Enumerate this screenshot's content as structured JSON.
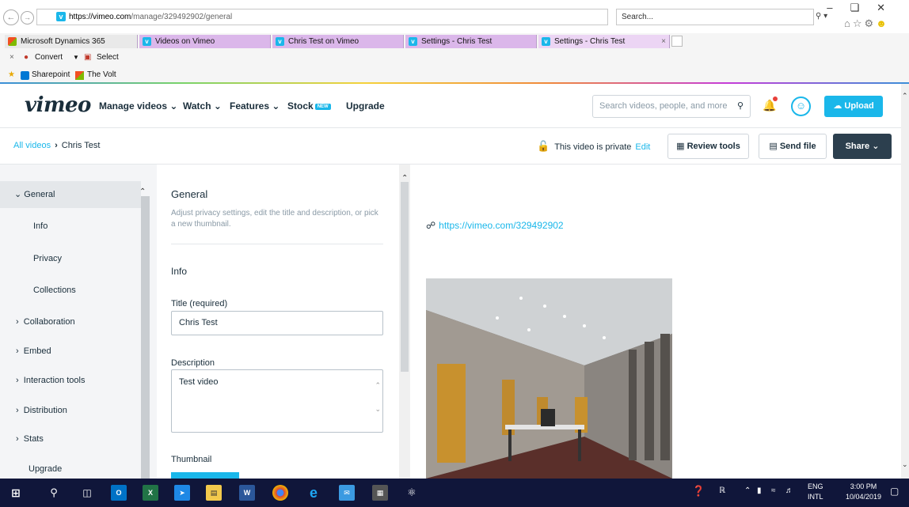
{
  "browser": {
    "url_base": "https://vimeo.com",
    "url_path": "/manage/329492902/general",
    "search_placeholder": "Search...",
    "tabs": [
      {
        "label": "Microsoft Dynamics 365"
      },
      {
        "label": "Videos on Vimeo"
      },
      {
        "label": "Chris Test on Vimeo"
      },
      {
        "label": "Settings - Chris Test"
      },
      {
        "label": "Settings - Chris Test"
      }
    ],
    "cmd_bar": {
      "convert": "Convert",
      "select": "Select"
    },
    "favorites": [
      {
        "label": "Sharepoint"
      },
      {
        "label": "The Volt"
      }
    ]
  },
  "vimeo": {
    "logo": "vimeo",
    "nav": [
      "Manage videos",
      "Watch",
      "Features",
      "Stock",
      "Upgrade"
    ],
    "new_badge": "NEW",
    "search_placeholder": "Search videos, people, and more",
    "upload_label": "Upload"
  },
  "subheader": {
    "crumb_link": "All videos",
    "crumb_current": "Chris Test",
    "private_text": "This video is private",
    "edit_label": "Edit",
    "review_tools": "Review tools",
    "send_file": "Send file",
    "share": "Share"
  },
  "sidebar": {
    "items": [
      "General",
      "Info",
      "Privacy",
      "Collections",
      "Collaboration",
      "Embed",
      "Interaction tools",
      "Distribution",
      "Stats",
      "Upgrade"
    ]
  },
  "form": {
    "heading": "General",
    "description": "Adjust privacy settings, edit the title and description, or pick a new thumbnail.",
    "section": "Info",
    "title_label": "Title (required)",
    "title_value": "Chris Test",
    "desc_label": "Description",
    "desc_value": "Test video",
    "thumb_label": "Thumbnail"
  },
  "preview": {
    "video_url": "https://vimeo.com/329492902"
  },
  "taskbar": {
    "lang_top": "ENG",
    "lang_bottom": "INTL",
    "time": "3:00 PM",
    "date": "10/04/2019"
  },
  "colors": {
    "vimeo_blue": "#1ab7ea",
    "dark": "#1a2e3b",
    "taskbar": "#10163a"
  }
}
